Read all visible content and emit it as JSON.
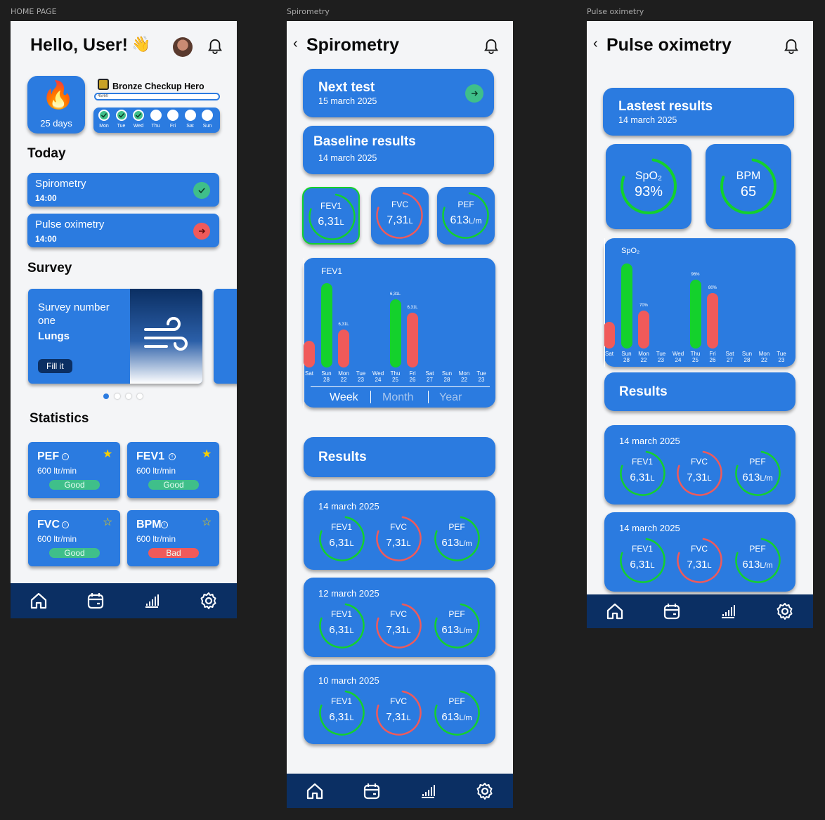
{
  "frames": {
    "home": "HOME PAGE",
    "spiro": "Spirometry",
    "pulse": "Pulse oximetry"
  },
  "home": {
    "greeting": "Hello, User!",
    "wave": "👋",
    "streak": {
      "days": "25 days"
    },
    "badge": {
      "title": "Bronze Checkup Hero",
      "progress_text": "45/60",
      "progress": 0.75
    },
    "week": [
      {
        "d": "Mon",
        "done": true
      },
      {
        "d": "Tue",
        "done": true
      },
      {
        "d": "Wed",
        "done": true
      },
      {
        "d": "Thu",
        "done": false
      },
      {
        "d": "Fri",
        "done": false
      },
      {
        "d": "Sat",
        "done": false
      },
      {
        "d": "Sun",
        "done": false
      }
    ],
    "today_title": "Today",
    "today": [
      {
        "name": "Spirometry",
        "time": "14:00",
        "status": "done"
      },
      {
        "name": "Pulse oximetry",
        "time": "14:00",
        "status": "go"
      }
    ],
    "survey_title": "Survey",
    "survey": {
      "line1": "Survey number",
      "line2": "one",
      "topic": "Lungs",
      "button": "Fill it"
    },
    "stats_title": "Statistics",
    "stats": [
      {
        "name": "PEF",
        "value": "600 ltr/min",
        "status": "Good",
        "starred": true
      },
      {
        "name": "FEV1",
        "value": "600 ltr/min",
        "status": "Good",
        "starred": true
      },
      {
        "name": "FVC",
        "value": "600 ltr/min",
        "status": "Good",
        "starred": false
      },
      {
        "name": "BPM",
        "value": "600 ltr/min",
        "status": "Bad",
        "starred": false
      }
    ]
  },
  "spiro": {
    "title": "Spirometry",
    "next": {
      "label": "Next test",
      "date": "15 march 2025"
    },
    "baseline": {
      "label": "Baseline results",
      "date": "14 march 2025"
    },
    "metrics": [
      {
        "name": "FEV1",
        "value": "6,31",
        "unit": "L"
      },
      {
        "name": "FVC",
        "value": "7,31",
        "unit": "L"
      },
      {
        "name": "PEF",
        "value": "613",
        "unit": "L/m"
      }
    ],
    "chart": {
      "title": "FEV1",
      "tabs": [
        "Week",
        "Month",
        "Year"
      ],
      "bar_label": "6,31L"
    },
    "results_title": "Results",
    "results": [
      {
        "date": "14 march 2025"
      },
      {
        "date": "12 march 2025"
      },
      {
        "date": "10 march 2025"
      }
    ]
  },
  "pulse": {
    "title": "Pulse oximetry",
    "latest": {
      "label": "Lastest results",
      "date": "14 march 2025"
    },
    "spo2": {
      "name": "SpO₂",
      "value": "93%"
    },
    "bpm": {
      "name": "BPM",
      "value": "65"
    },
    "chart": {
      "title": "SpO₂",
      "labels": [
        "70%",
        "96%",
        "80%"
      ]
    },
    "results_title": "Results",
    "results": [
      {
        "date": "14 march 2025"
      },
      {
        "date": "14 march 2025"
      }
    ]
  },
  "chart_data": {
    "type": "bar",
    "title": "FEV1",
    "categories": [
      "Sat",
      "Sun 28",
      "Mon 22",
      "Tue 23",
      "Wed 24",
      "Thu 25",
      "Fri 26",
      "Sat 27",
      "Sun 28",
      "Mon 22",
      "Tue 23"
    ],
    "values": [
      2.2,
      6.9,
      3.1,
      0,
      0,
      5.6,
      4.5,
      0,
      0,
      0,
      0
    ]
  },
  "colors": {
    "accent": "#2b7be0",
    "good": "#14d12c",
    "bad": "#f05a5a",
    "nav": "#0b2f63"
  }
}
